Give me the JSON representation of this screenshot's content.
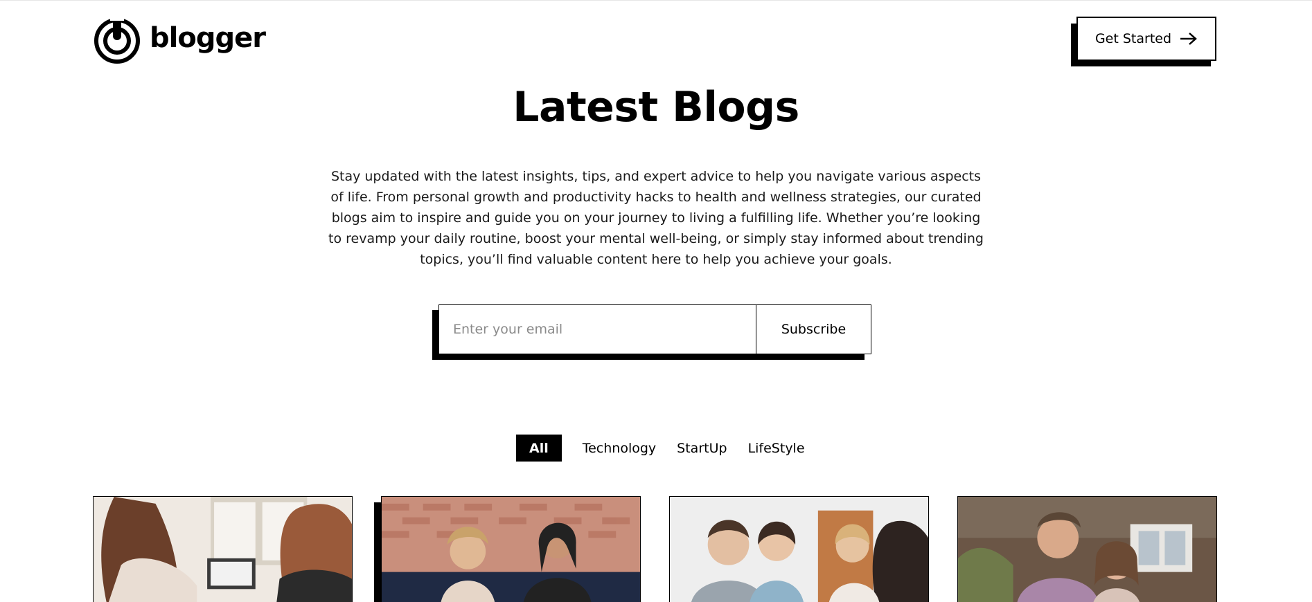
{
  "header": {
    "logo_text": "blogger",
    "cta_label": "Get Started",
    "cta_icon": "arrow-right-icon"
  },
  "hero": {
    "title": "Latest Blogs",
    "description": "Stay updated with the latest insights, tips, and expert advice to help you navigate various aspects of life. From personal growth and productivity hacks to health and wellness strategies, our curated blogs aim to inspire and guide you on your journey to living a fulfilling life. Whether you’re looking to revamp your daily routine, boost your mental well-being, or simply stay informed about trending topics, you’ll find valuable content here to help you achieve your goals."
  },
  "subscribe": {
    "placeholder": "Enter your email",
    "value": "",
    "button_label": "Subscribe"
  },
  "tabs": [
    {
      "label": "All",
      "active": true
    },
    {
      "label": "Technology",
      "active": false
    },
    {
      "label": "StartUp",
      "active": false
    },
    {
      "label": "LifeStyle",
      "active": false
    }
  ],
  "cards": [
    {
      "image": "two-women-at-laptop-photo"
    },
    {
      "image": "two-women-talking-office-photo"
    },
    {
      "image": "group-of-friends-laughing-photo"
    },
    {
      "image": "smiling-couple-outdoors-photo"
    }
  ],
  "colors": {
    "primary": "#000000",
    "background": "#ffffff",
    "placeholder": "#8a8a8a"
  }
}
